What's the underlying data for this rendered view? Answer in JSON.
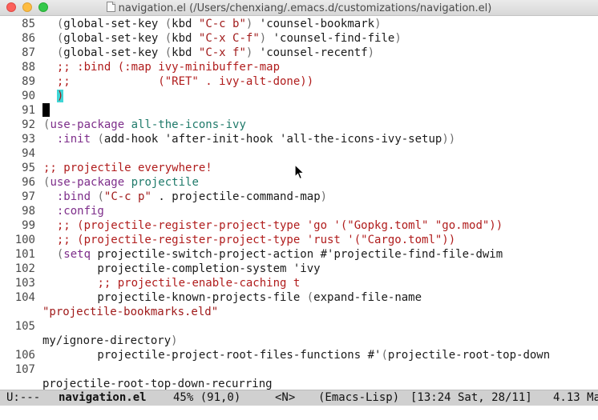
{
  "window": {
    "title": "navigation.el (/Users/chenxiang/.emacs.d/customizations/navigation.el)"
  },
  "colors": {
    "string": "#a01a1a",
    "comment": "#b01c1c",
    "keyword": "#7d2d8a",
    "function": "#1f7a6a",
    "paren_highlight": "#3fd6d6",
    "modeline_bg": "#d0d0d0"
  },
  "lines": [
    {
      "num": "85",
      "parts": [
        [
          "t",
          "  "
        ],
        [
          "par",
          "("
        ],
        [
          "t",
          "global-set-key "
        ],
        [
          "par",
          "("
        ],
        [
          "t",
          "kbd "
        ],
        [
          "str",
          "\"C-c b\""
        ],
        [
          "par",
          ")"
        ],
        [
          "t",
          " 'counsel-bookmark"
        ],
        [
          "par",
          ")"
        ]
      ]
    },
    {
      "num": "86",
      "parts": [
        [
          "t",
          "  "
        ],
        [
          "par",
          "("
        ],
        [
          "t",
          "global-set-key "
        ],
        [
          "par",
          "("
        ],
        [
          "t",
          "kbd "
        ],
        [
          "str",
          "\"C-x C-f\""
        ],
        [
          "par",
          ")"
        ],
        [
          "t",
          " 'counsel-find-file"
        ],
        [
          "par",
          ")"
        ]
      ]
    },
    {
      "num": "87",
      "parts": [
        [
          "t",
          "  "
        ],
        [
          "par",
          "("
        ],
        [
          "t",
          "global-set-key "
        ],
        [
          "par",
          "("
        ],
        [
          "t",
          "kbd "
        ],
        [
          "str",
          "\"C-x f\""
        ],
        [
          "par",
          ")"
        ],
        [
          "t",
          " 'counsel-recentf"
        ],
        [
          "par",
          ")"
        ]
      ]
    },
    {
      "num": "88",
      "parts": [
        [
          "t",
          "  "
        ],
        [
          "cmt",
          ";; :bind (:map ivy-minibuffer-map"
        ]
      ]
    },
    {
      "num": "89",
      "parts": [
        [
          "t",
          "  "
        ],
        [
          "cmt",
          ";;             (\"RET\" . ivy-alt-done))"
        ]
      ]
    },
    {
      "num": "90",
      "parts": [
        [
          "t",
          "  "
        ],
        [
          "hl",
          ")"
        ]
      ]
    },
    {
      "num": "91",
      "parts": [],
      "cursor": true
    },
    {
      "num": "92",
      "parts": [
        [
          "par",
          "("
        ],
        [
          "kw",
          "use-package"
        ],
        [
          "t",
          " "
        ],
        [
          "fn",
          "all-the-icons-ivy"
        ]
      ]
    },
    {
      "num": "93",
      "parts": [
        [
          "t",
          "  "
        ],
        [
          "kw",
          ":init"
        ],
        [
          "t",
          " "
        ],
        [
          "par",
          "("
        ],
        [
          "t",
          "add-hook 'after-init-hook 'all-the-icons-ivy-setup"
        ],
        [
          "par",
          "))"
        ]
      ]
    },
    {
      "num": "94",
      "parts": []
    },
    {
      "num": "95",
      "parts": [
        [
          "cmt",
          ";; projectile everywhere!"
        ]
      ]
    },
    {
      "num": "96",
      "parts": [
        [
          "par",
          "("
        ],
        [
          "kw",
          "use-package"
        ],
        [
          "t",
          " "
        ],
        [
          "fn",
          "projectile"
        ]
      ]
    },
    {
      "num": "97",
      "parts": [
        [
          "t",
          "  "
        ],
        [
          "kw",
          ":bind"
        ],
        [
          "t",
          " "
        ],
        [
          "par",
          "("
        ],
        [
          "str",
          "\"C-c p\""
        ],
        [
          "t",
          " . projectile-command-map"
        ],
        [
          "par",
          ")"
        ]
      ]
    },
    {
      "num": "98",
      "parts": [
        [
          "t",
          "  "
        ],
        [
          "kw",
          ":config"
        ]
      ]
    },
    {
      "num": "99",
      "parts": [
        [
          "t",
          "  "
        ],
        [
          "cmt",
          ";; (projectile-register-project-type 'go '(\"Gopkg.toml\" \"go.mod\"))"
        ]
      ]
    },
    {
      "num": "100",
      "parts": [
        [
          "t",
          "  "
        ],
        [
          "cmt",
          ";; (projectile-register-project-type 'rust '(\"Cargo.toml\"))"
        ]
      ]
    },
    {
      "num": "101",
      "parts": [
        [
          "t",
          "  "
        ],
        [
          "par",
          "("
        ],
        [
          "kw",
          "setq"
        ],
        [
          "t",
          " projectile-switch-project-action #'projectile-find-file-dwim"
        ]
      ]
    },
    {
      "num": "102",
      "parts": [
        [
          "t",
          "        projectile-completion-system 'ivy"
        ]
      ]
    },
    {
      "num": "103",
      "parts": [
        [
          "t",
          "        "
        ],
        [
          "cmt",
          ";; projectile-enable-caching t"
        ]
      ]
    },
    {
      "num": "104",
      "parts": [
        [
          "t",
          "        projectile-known-projects-file "
        ],
        [
          "par",
          "("
        ],
        [
          "t",
          "expand-file-name"
        ]
      ]
    },
    {
      "num": "",
      "wrap": true,
      "parts": [
        [
          "str",
          "\"projectile-bookmarks.eld\""
        ]
      ]
    },
    {
      "num": "105",
      "parts": []
    },
    {
      "num": "",
      "wrap": true,
      "parts": [
        [
          "t",
          "my/ignore-directory"
        ],
        [
          "par",
          ")"
        ]
      ]
    },
    {
      "num": "106",
      "parts": [
        [
          "t",
          "        projectile-project-root-files-functions #'"
        ],
        [
          "par",
          "("
        ],
        [
          "t",
          "projectile-root-top-down"
        ]
      ]
    },
    {
      "num": "107",
      "parts": []
    },
    {
      "num": "",
      "wrap": true,
      "parts": [
        [
          "t",
          "projectile-root-top-down-recurring"
        ]
      ]
    }
  ],
  "modeline": {
    "status": "U:---",
    "buffer": "navigation.el",
    "position": "45% (91,0)",
    "state": "<N>",
    "mode": "(Emacs-Lisp)",
    "time": "[13:24 Sat, 28/11]",
    "load": "4.13 Ma"
  }
}
